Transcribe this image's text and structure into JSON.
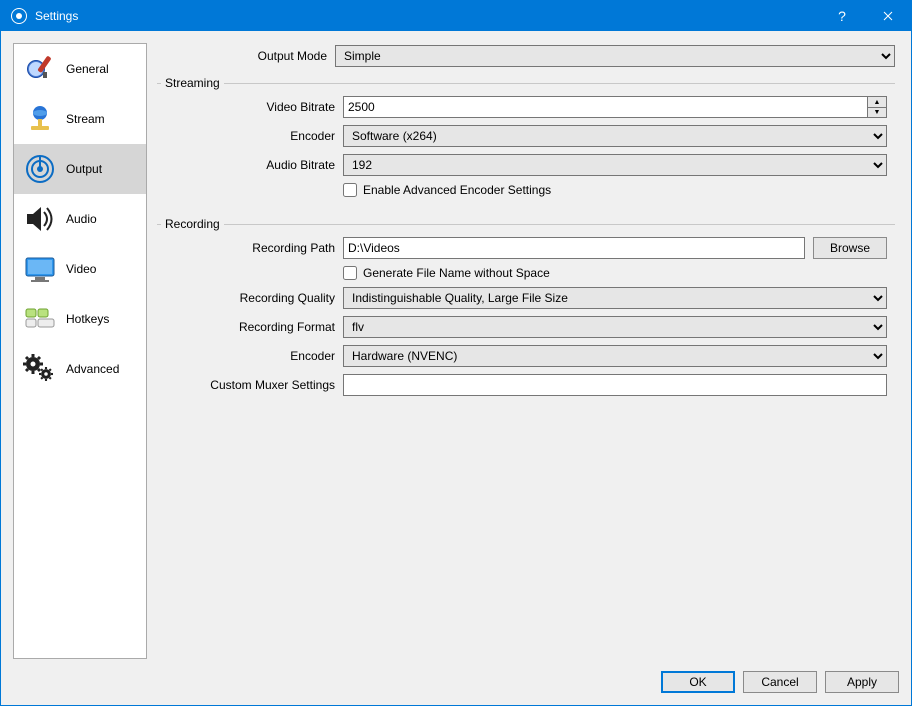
{
  "window": {
    "title": "Settings"
  },
  "sidebar": {
    "items": [
      {
        "label": "General",
        "icon": "general-icon",
        "selected": false
      },
      {
        "label": "Stream",
        "icon": "stream-icon",
        "selected": false
      },
      {
        "label": "Output",
        "icon": "output-icon",
        "selected": true
      },
      {
        "label": "Audio",
        "icon": "audio-icon",
        "selected": false
      },
      {
        "label": "Video",
        "icon": "video-icon",
        "selected": false
      },
      {
        "label": "Hotkeys",
        "icon": "hotkeys-icon",
        "selected": false
      },
      {
        "label": "Advanced",
        "icon": "advanced-icon",
        "selected": false
      }
    ]
  },
  "output": {
    "output_mode": {
      "label": "Output Mode",
      "value": "Simple"
    },
    "streaming": {
      "title": "Streaming",
      "video_bitrate": {
        "label": "Video Bitrate",
        "value": "2500"
      },
      "encoder": {
        "label": "Encoder",
        "value": "Software (x264)"
      },
      "audio_bitrate": {
        "label": "Audio Bitrate",
        "value": "192"
      },
      "enable_advanced": {
        "label": "Enable Advanced Encoder Settings",
        "checked": false
      }
    },
    "recording": {
      "title": "Recording",
      "path": {
        "label": "Recording Path",
        "value": "D:\\Videos"
      },
      "browse_label": "Browse",
      "gen_no_space": {
        "label": "Generate File Name without Space",
        "checked": false
      },
      "quality": {
        "label": "Recording Quality",
        "value": "Indistinguishable Quality, Large File Size"
      },
      "format": {
        "label": "Recording Format",
        "value": "flv"
      },
      "encoder": {
        "label": "Encoder",
        "value": "Hardware (NVENC)"
      },
      "muxer": {
        "label": "Custom Muxer Settings",
        "value": ""
      }
    }
  },
  "footer": {
    "ok": "OK",
    "cancel": "Cancel",
    "apply": "Apply"
  },
  "titlebar": {
    "help": "?",
    "close": "✕"
  }
}
